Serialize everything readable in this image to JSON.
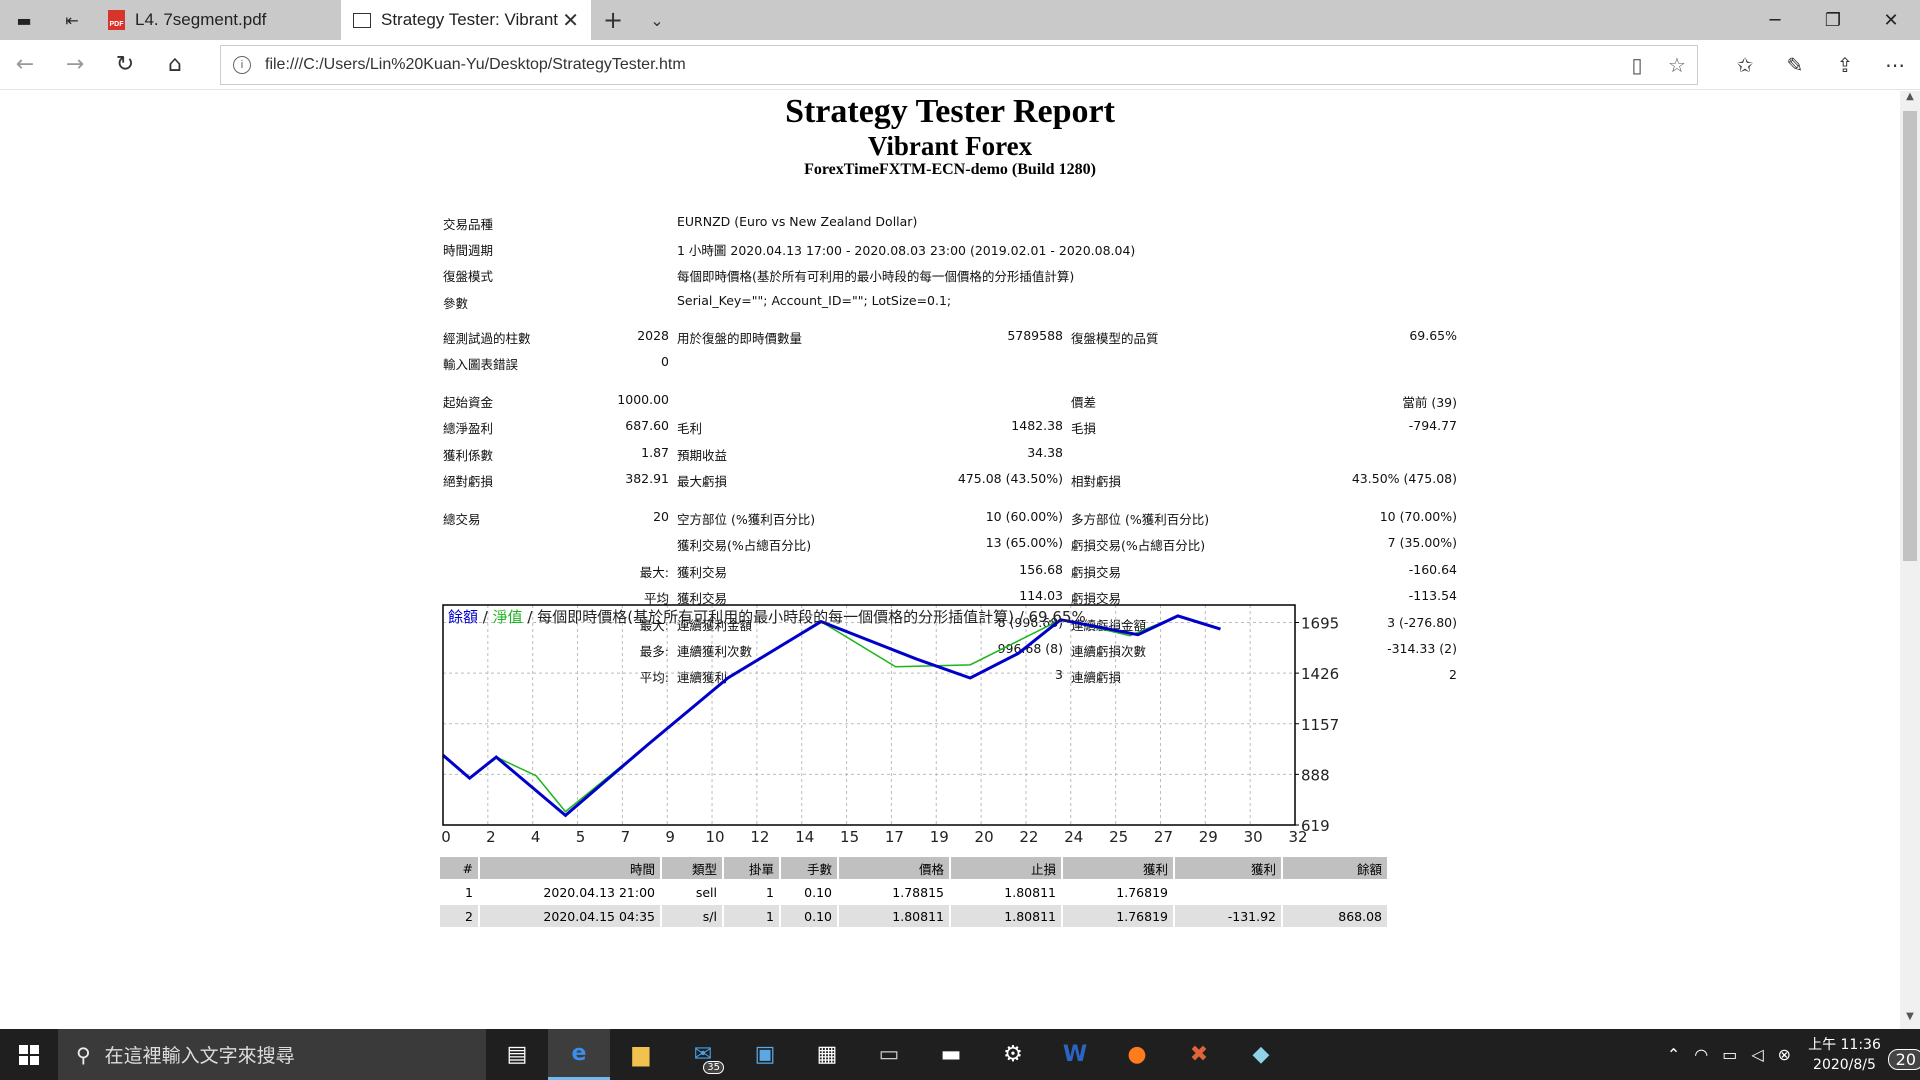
{
  "browser": {
    "tabs": [
      {
        "label": "L4. 7segment.pdf",
        "icon": "pdf-icon"
      },
      {
        "label": "Strategy Tester: Vibrant",
        "icon": "page-icon"
      }
    ],
    "url": "file:///C:/Users/Lin%20Kuan-Yu/Desktop/StrategyTester.htm"
  },
  "report": {
    "title": "Strategy Tester Report",
    "subtitle": "Vibrant Forex",
    "server": "ForexTimeFXTM-ECN-demo (Build 1280)",
    "info": [
      {
        "label": "交易品種",
        "value": "EURNZD (Euro vs New Zealand Dollar)"
      },
      {
        "label": "時間週期",
        "value": "1 小時圖 2020.04.13 17:00 - 2020.08.03 23:00 (2019.02.01 - 2020.08.04)"
      },
      {
        "label": "復盤模式",
        "value": "每個即時價格(基於所有可利用的最小時段的每一個價格的分形插值計算)"
      },
      {
        "label": "參數",
        "value": "Serial_Key=\"\"; Account_ID=\"\"; LotSize=0.1;"
      }
    ],
    "stats1": {
      "bars_label": "經測試過的柱數",
      "bars": "2028",
      "ticks_label": "用於復盤的即時價數量",
      "ticks": "5789588",
      "quality_label": "復盤模型的品質",
      "quality": "69.65%",
      "errors_label": "輸入圖表錯誤",
      "errors": "0"
    },
    "stats2": {
      "deposit_label": "起始資金",
      "deposit": "1000.00",
      "spread_label": "價差",
      "spread": "當前 (39)",
      "net_label": "總淨盈利",
      "net": "687.60",
      "gross_profit_label": "毛利",
      "gross_profit": "1482.38",
      "gross_loss_label": "毛損",
      "gross_loss": "-794.77",
      "pf_label": "獲利係數",
      "pf": "1.87",
      "payoff_label": "預期收益",
      "payoff": "34.38",
      "abs_dd_label": "絕對虧損",
      "abs_dd": "382.91",
      "max_dd_label": "最大虧損",
      "max_dd": "475.08 (43.50%)",
      "rel_dd_label": "相對虧損",
      "rel_dd": "43.50% (475.08)"
    },
    "stats3": {
      "total_label": "總交易",
      "total": "20",
      "short_label": "空方部位 (%獲利百分比)",
      "short": "10 (60.00%)",
      "long_label": "多方部位 (%獲利百分比)",
      "long": "10 (70.00%)",
      "win_label": "獲利交易(%占總百分比)",
      "win": "13 (65.00%)",
      "loss_label": "虧損交易(%占總百分比)",
      "loss": "7 (35.00%)",
      "largest_prefix": "最大:",
      "largest_win_label": "獲利交易",
      "largest_win": "156.68",
      "largest_loss_label": "虧損交易",
      "largest_loss": "-160.64",
      "avg_prefix": "平均",
      "avg_win_label": "獲利交易",
      "avg_win": "114.03",
      "avg_loss_label": "虧損交易",
      "avg_loss": "-113.54",
      "max_prefix": "最大:",
      "max_cons_win_label": "連續獲利金額",
      "max_cons_win": "8 (996.68)",
      "max_cons_loss_label": "連續虧損金額",
      "max_cons_loss": "3 (-276.80)",
      "most_prefix": "最多:",
      "most_cons_win_label": "連續獲利次數",
      "most_cons_win": "996.68 (8)",
      "most_cons_loss_label": "連續虧損次數",
      "most_cons_loss": "-314.33 (2)",
      "avgc_prefix": "平均:",
      "avg_cons_win_label": "連續獲利",
      "avg_cons_win": "3",
      "avg_cons_loss_label": "連續虧損",
      "avg_cons_loss": "2"
    },
    "legend": {
      "balance": "餘額",
      "sep1": " / ",
      "equity": "淨值",
      "sep2": " / ",
      "rest": "每個即時價格(基於所有可利用的最小時段的每一個價格的分形插值計算) / 69.65%"
    },
    "table": {
      "headers": [
        "#",
        "時間",
        "類型",
        "掛單",
        "手數",
        "價格",
        "止損",
        "獲利",
        "獲利",
        "餘額"
      ],
      "rows": [
        [
          "1",
          "2020.04.13 21:00",
          "sell",
          "1",
          "0.10",
          "1.78815",
          "1.80811",
          "1.76819",
          "",
          ""
        ],
        [
          "2",
          "2020.04.15 04:35",
          "s/l",
          "1",
          "0.10",
          "1.80811",
          "1.80811",
          "1.76819",
          "-131.92",
          "868.08"
        ]
      ]
    }
  },
  "chart_data": {
    "type": "line",
    "xlim": [
      0,
      32
    ],
    "ylim": [
      619,
      1788
    ],
    "x_ticks": [
      "0",
      "2",
      "4",
      "5",
      "7",
      "9",
      "10",
      "12",
      "14",
      "15",
      "17",
      "19",
      "20",
      "22",
      "24",
      "25",
      "27",
      "29",
      "30",
      "32"
    ],
    "y_ticks": [
      "1695",
      "1426",
      "1157",
      "888",
      "619"
    ],
    "series": [
      {
        "name": "餘額",
        "color": "#0000c8",
        "x": [
          0,
          1,
          2,
          4.6,
          7.7,
          10.7,
          14.2,
          17.8,
          19.8,
          21.6,
          23.2,
          26.1,
          27.6,
          29.2
        ],
        "y": [
          990,
          868,
          980,
          670,
          1047,
          1400,
          1700,
          1500,
          1400,
          1530,
          1710,
          1630,
          1730,
          1660
        ]
      },
      {
        "name": "淨值",
        "color": "#1cb51c",
        "x": [
          0,
          1,
          2,
          3.5,
          4.6,
          7.7,
          10.7,
          14.2,
          17,
          19.8,
          23.2,
          25.8,
          27.6,
          29.2
        ],
        "y": [
          990,
          868,
          980,
          880,
          690,
          1047,
          1400,
          1700,
          1460,
          1470,
          1710,
          1625,
          1730,
          1660
        ]
      }
    ]
  },
  "taskbar": {
    "search_placeholder": "在這裡輸入文字來搜尋",
    "mail_badge": "35",
    "notif_badge": "20",
    "time": "上午 11:36",
    "date": "2020/8/5"
  }
}
